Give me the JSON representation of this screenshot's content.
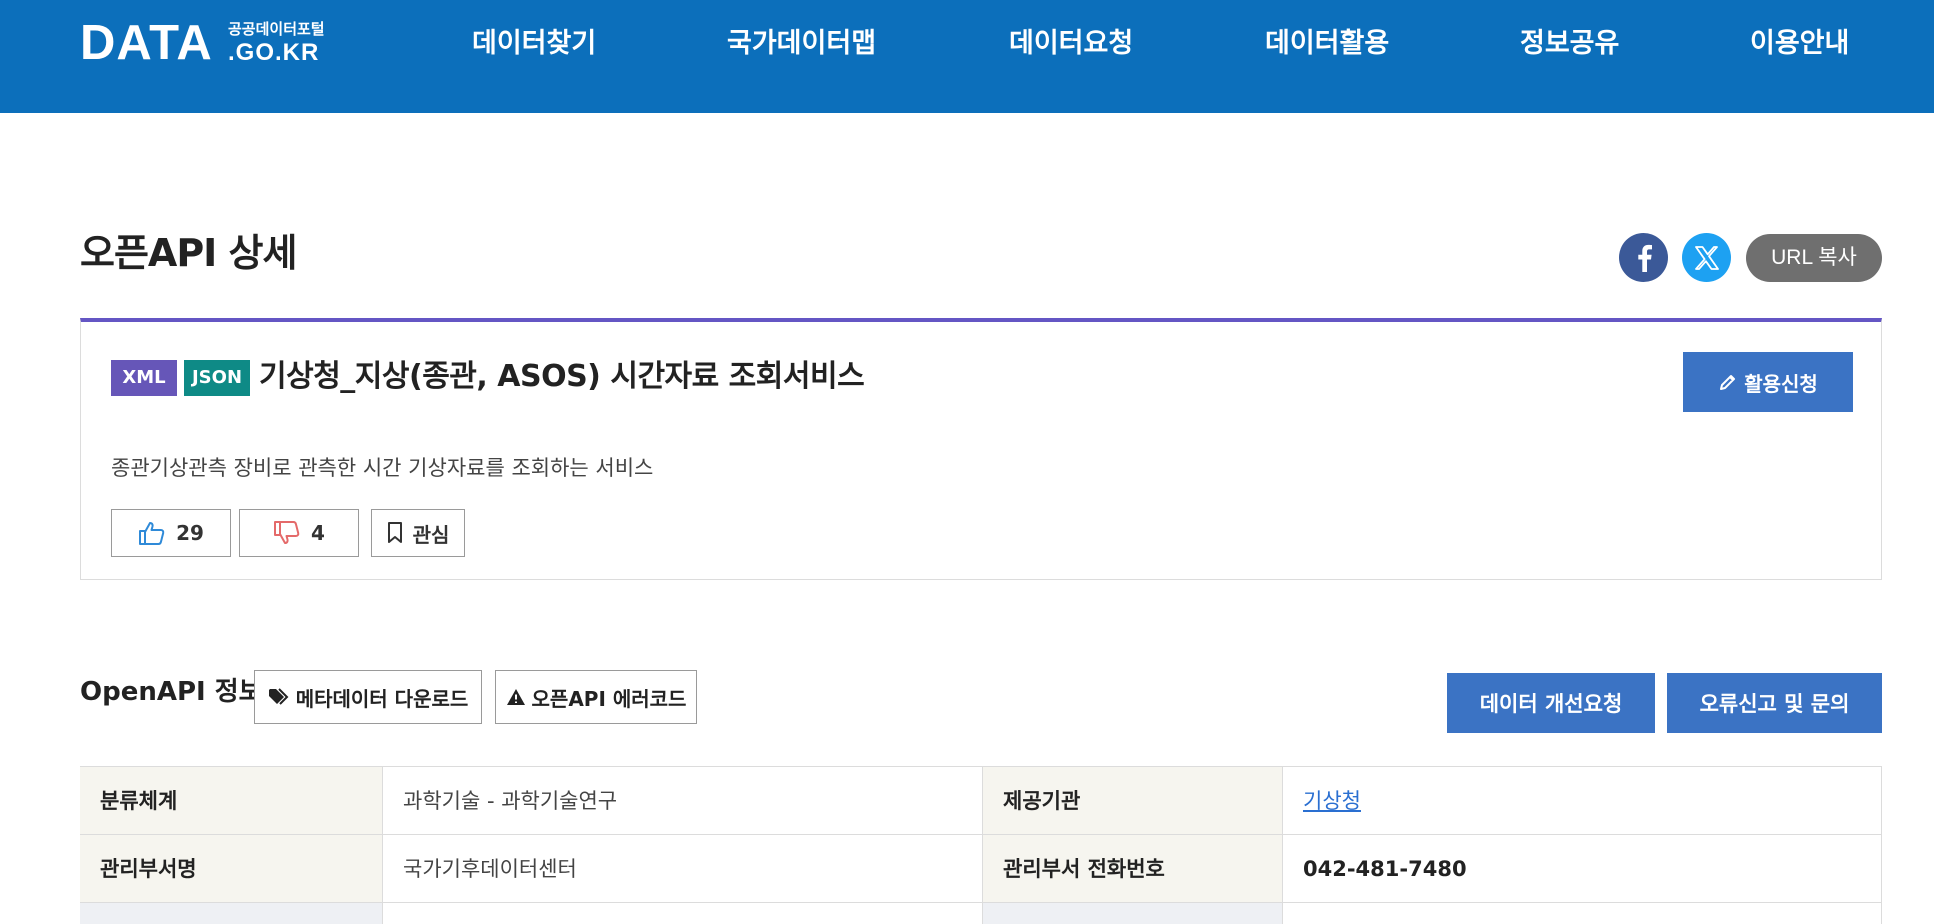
{
  "header": {
    "logo_main": "DATA",
    "logo_sub_top": "공공데이터포털",
    "logo_sub_bottom": ".GO.KR",
    "nav": [
      "데이터찾기",
      "국가데이터맵",
      "데이터요청",
      "데이터활용",
      "정보공유",
      "이용안내"
    ]
  },
  "page": {
    "title": "오픈API 상세",
    "share": {
      "facebook_icon": "facebook-icon",
      "x_icon": "x-twitter-icon",
      "url_copy_label": "URL 복사"
    }
  },
  "detail": {
    "badges": [
      "XML",
      "JSON"
    ],
    "title": "기상청_지상(종관, ASOS) 시간자료 조회서비스",
    "apply_label": "활용신청",
    "description": "종관기상관측 장비로 관측한 시간 기상자료를 조회하는 서비스",
    "like_count": "29",
    "dislike_count": "4",
    "favorite_label": "관심"
  },
  "openapi_info": {
    "title": "OpenAPI 정보",
    "metadata_download_label": "메타데이터 다운로드",
    "error_code_label": "오픈API 에러코드",
    "improve_request_label": "데이터 개선요청",
    "report_label": "오류신고 및 문의",
    "rows": [
      {
        "label1": "분류체계",
        "value1": "과학기술 - 과학기술연구",
        "label2": "제공기관",
        "value2": "기상청"
      },
      {
        "label1": "관리부서명",
        "value1": "국가기후데이터센터",
        "label2": "관리부서 전화번호",
        "value2": "042-481-7480"
      }
    ]
  },
  "colors": {
    "header_bg": "#0c6fbb",
    "accent_purple": "#6456c4",
    "button_blue": "#3b73c4",
    "xml_badge": "#6656b8",
    "json_badge": "#0e8a86"
  }
}
